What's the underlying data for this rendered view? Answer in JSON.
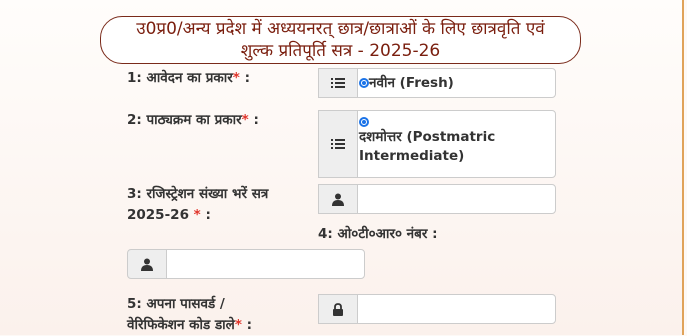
{
  "header": {
    "title_line1": "उ0प्र0/अन्य प्रदेश में अध्ययनरत् छात्र/छात्राओं के लिए छात्रवृति एवं",
    "title_line2": "शुल्क प्रतिपूर्ति सत्र - 2025-26"
  },
  "form": {
    "application_type": {
      "label": "1: आवेदन का प्रकार",
      "required_mark": "*",
      "colon": ":",
      "addon_icon": "list-icon",
      "option_label": "नवीन (Fresh)",
      "selected": true
    },
    "course_type": {
      "label": "2: पाठ्यक्रम का प्रकार",
      "required_mark": "*",
      "colon": ":",
      "addon_icon": "list-icon",
      "option_label_line1": "दशमोत्तर (Postmatric",
      "option_label_line2": "Intermediate)",
      "selected": true
    },
    "registration_number": {
      "label_line1": "3: रजिस्ट्रेशन संख्या भरें सत्र",
      "label_line2": "2025-26",
      "required_mark": "*",
      "colon": ":",
      "addon_icon": "user-icon",
      "value": ""
    },
    "otr_number": {
      "label": "4: ओ०टी०आर० नंबर :",
      "addon_icon": "user-icon",
      "value": ""
    },
    "password": {
      "label_line1": "5: अपना पासवर्ड /",
      "label_line2": "वेरिफिकेशन कोड डाले",
      "required_mark": "*",
      "colon": ":",
      "addon_icon": "lock-icon",
      "value": ""
    }
  }
}
